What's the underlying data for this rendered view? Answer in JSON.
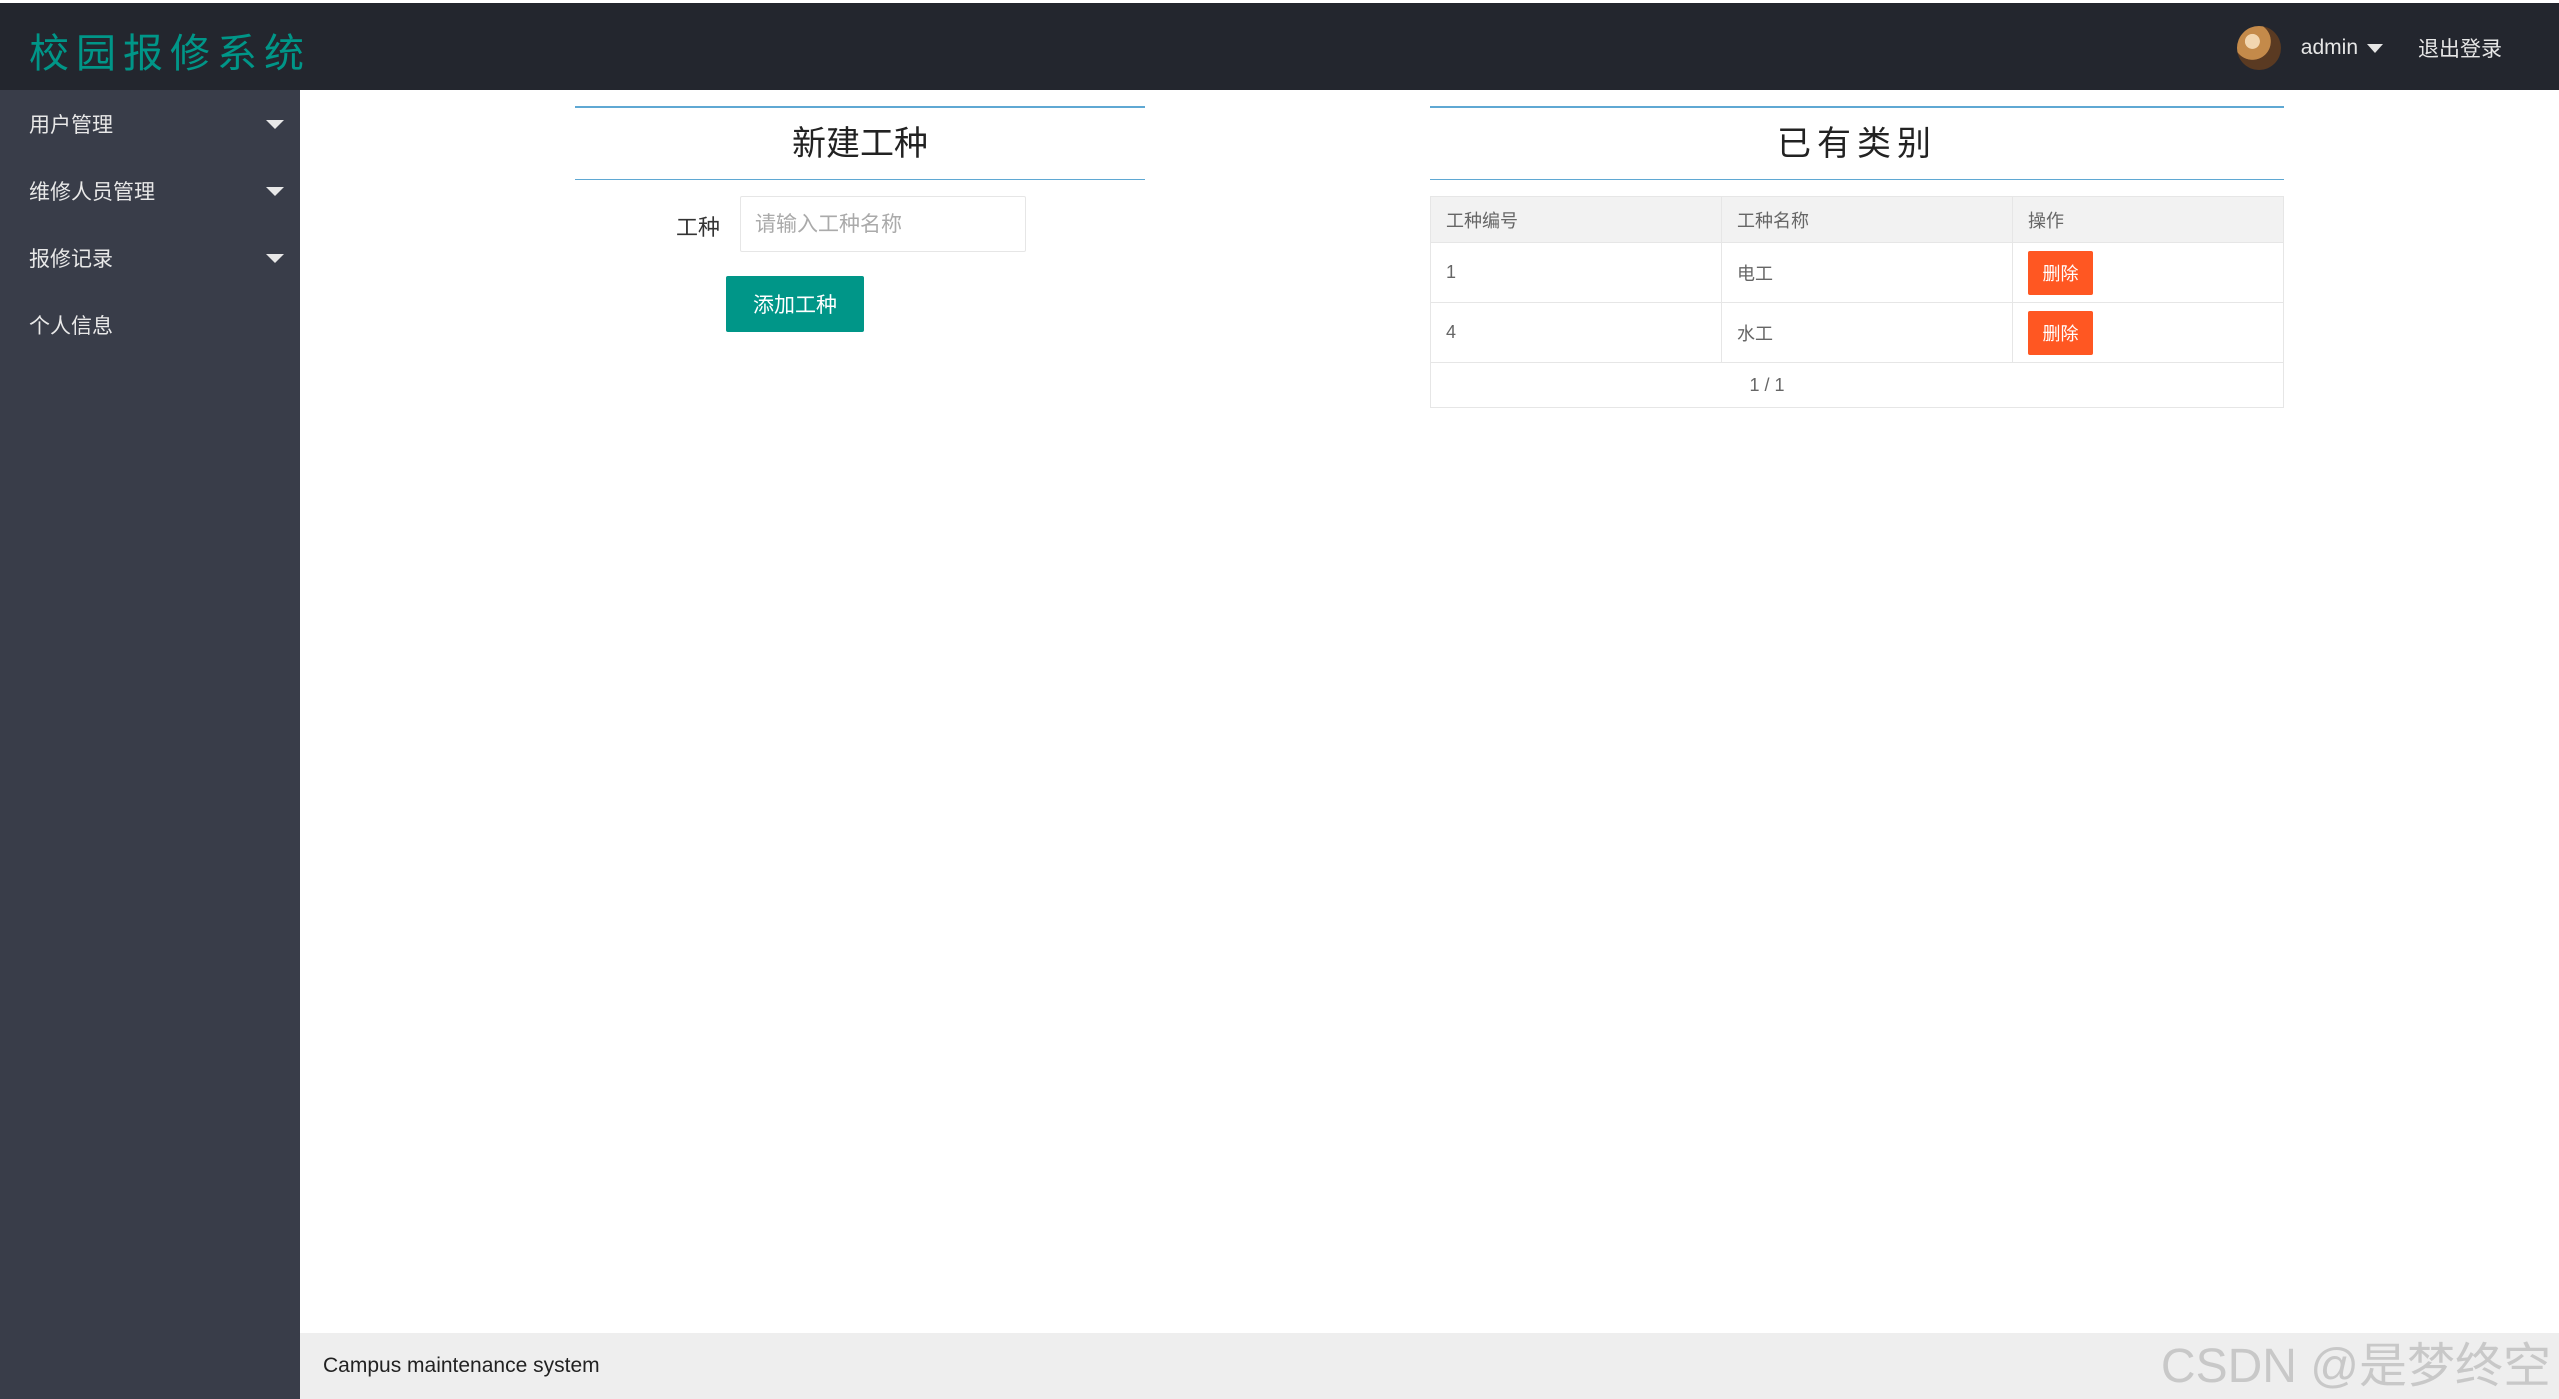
{
  "header": {
    "brand": "校园报修系统",
    "username": "admin",
    "logout_label": "退出登录"
  },
  "sidebar": {
    "items": [
      {
        "label": "用户管理",
        "has_caret": true
      },
      {
        "label": "维修人员管理",
        "has_caret": true
      },
      {
        "label": "报修记录",
        "has_caret": true
      },
      {
        "label": "个人信息",
        "has_caret": false
      }
    ]
  },
  "create_panel": {
    "title": "新建工种",
    "field_label": "工种",
    "field_placeholder": "请输入工种名称",
    "field_value": "",
    "submit_label": "添加工种"
  },
  "list_panel": {
    "title": "已有类别",
    "columns": [
      "工种编号",
      "工种名称",
      "操作"
    ],
    "rows": [
      {
        "id": "1",
        "name": "电工",
        "action_label": "删除"
      },
      {
        "id": "4",
        "name": "水工",
        "action_label": "删除"
      }
    ],
    "pagination": "1 / 1"
  },
  "footer": {
    "text": "Campus maintenance system"
  },
  "watermark": "CSDN @是梦终空",
  "colors": {
    "header_bg": "#23262e",
    "sidebar_bg": "#393d49",
    "brand": "#009688",
    "primary_button": "#009688",
    "danger_button": "#ff5722",
    "title_rule": "#5fa8d3"
  }
}
